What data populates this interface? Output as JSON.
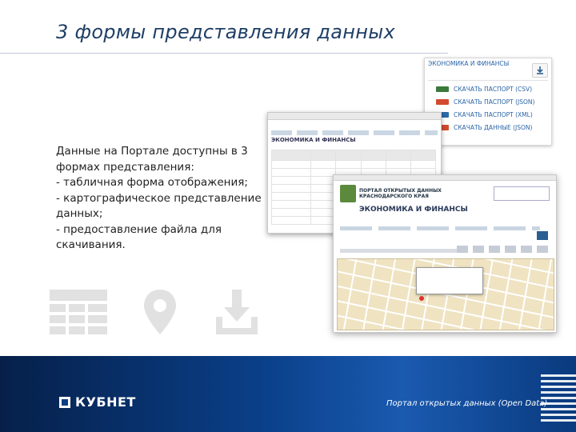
{
  "slide": {
    "title": "3 формы представления данных",
    "description_lines": [
      "Данные на Портале доступны в 3",
      "формах представления:",
      "- табличная форма отображения;",
      "- картографическое представление",
      "данных;",
      "- предоставление файла для",
      "скачивания."
    ]
  },
  "download_panel": {
    "heading": "ЭКОНОМИКА И ФИНАНСЫ",
    "items": [
      {
        "format": "CSV",
        "label": "СКАЧАТЬ ПАСПОРТ (CSV)"
      },
      {
        "format": "JSON",
        "label": "СКАЧАТЬ ПАСПОРТ (JSON)"
      },
      {
        "format": "XML",
        "label": "СКАЧАТЬ ПАСПОРТ (XML)"
      },
      {
        "format": "JSON",
        "label": "СКАЧАТЬ ДАННЫЕ (JSON)"
      }
    ],
    "colors": {
      "csv": "#3b7a3b",
      "json": "#d24a2e",
      "xml": "#2b6aa6"
    }
  },
  "table_screenshot": {
    "section_title": "ЭКОНОМИКА И ФИНАНСЫ"
  },
  "map_screenshot": {
    "brand": "ПОРТАЛ ОТКРЫТЫХ ДАННЫХ КРАСНОДАРСКОГО КРАЯ",
    "section_title": "ЭКОНОМИКА И ФИНАНСЫ"
  },
  "icons": [
    "table-icon",
    "map-pin-icon",
    "download-icon"
  ],
  "footer": {
    "logo_text": "КУБНЕТ",
    "note": "Портал открытых данных (Open Data)"
  }
}
